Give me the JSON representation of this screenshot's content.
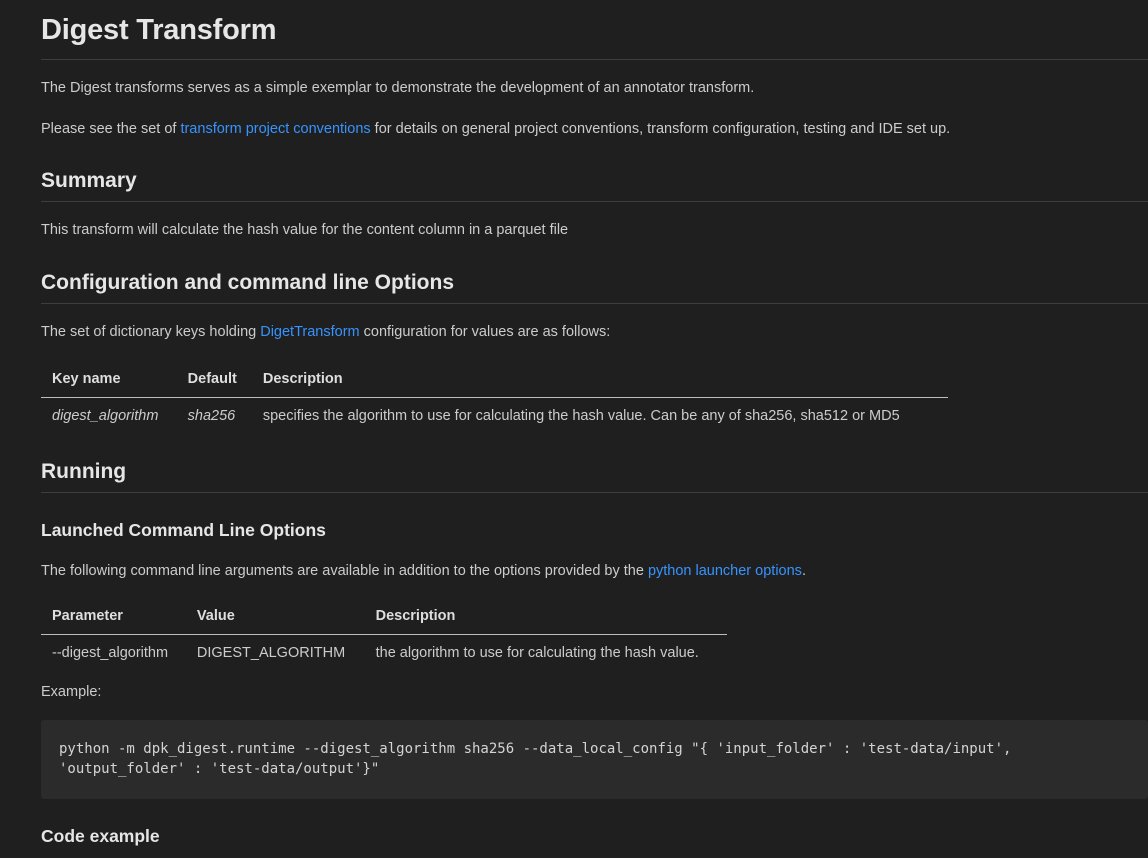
{
  "title": "Digest Transform",
  "intro": "The Digest transforms serves as a simple exemplar to demonstrate the development of an annotator transform.",
  "conventions": {
    "before": "Please see the set of ",
    "link": "transform project conventions",
    "after": " for details on general project conventions, transform configuration, testing and IDE set up."
  },
  "summary": {
    "heading": "Summary",
    "text": "This transform will calculate the hash value for the content column in a parquet file"
  },
  "config": {
    "heading": "Configuration and command line Options",
    "before": "The set of dictionary keys holding ",
    "link": "DigetTransform",
    "after": " configuration for values are as follows:",
    "columns": [
      "Key name",
      "Default",
      "Description"
    ],
    "rows": [
      [
        "digest_algorithm",
        "sha256",
        "specifies the algorithm to use for calculating the hash value. Can be any of sha256, sha512 or MD5"
      ]
    ]
  },
  "running": {
    "heading": "Running",
    "subheading": "Launched Command Line Options",
    "before": "The following command line arguments are available in addition to the options provided by the ",
    "link": "python launcher options",
    "after": ".",
    "columns": [
      "Parameter",
      "Value",
      "Description"
    ],
    "rows": [
      [
        "--digest_algorithm",
        "DIGEST_ALGORITHM",
        "the algorithm to use for calculating the hash value."
      ]
    ],
    "example_label": "Example:",
    "code_line1": "python -m dpk_digest.runtime --digest_algorithm sha256 --data_local_config \"{ 'input_folder' : 'test-data/input',",
    "code_line2": "'output_folder' : 'test-data/output'}\""
  },
  "code_example_heading": "Code example",
  "colors": {
    "background": "#1f1f1f",
    "text": "#cccccc",
    "link": "#3794ff",
    "code_background": "#2b2b2b"
  }
}
